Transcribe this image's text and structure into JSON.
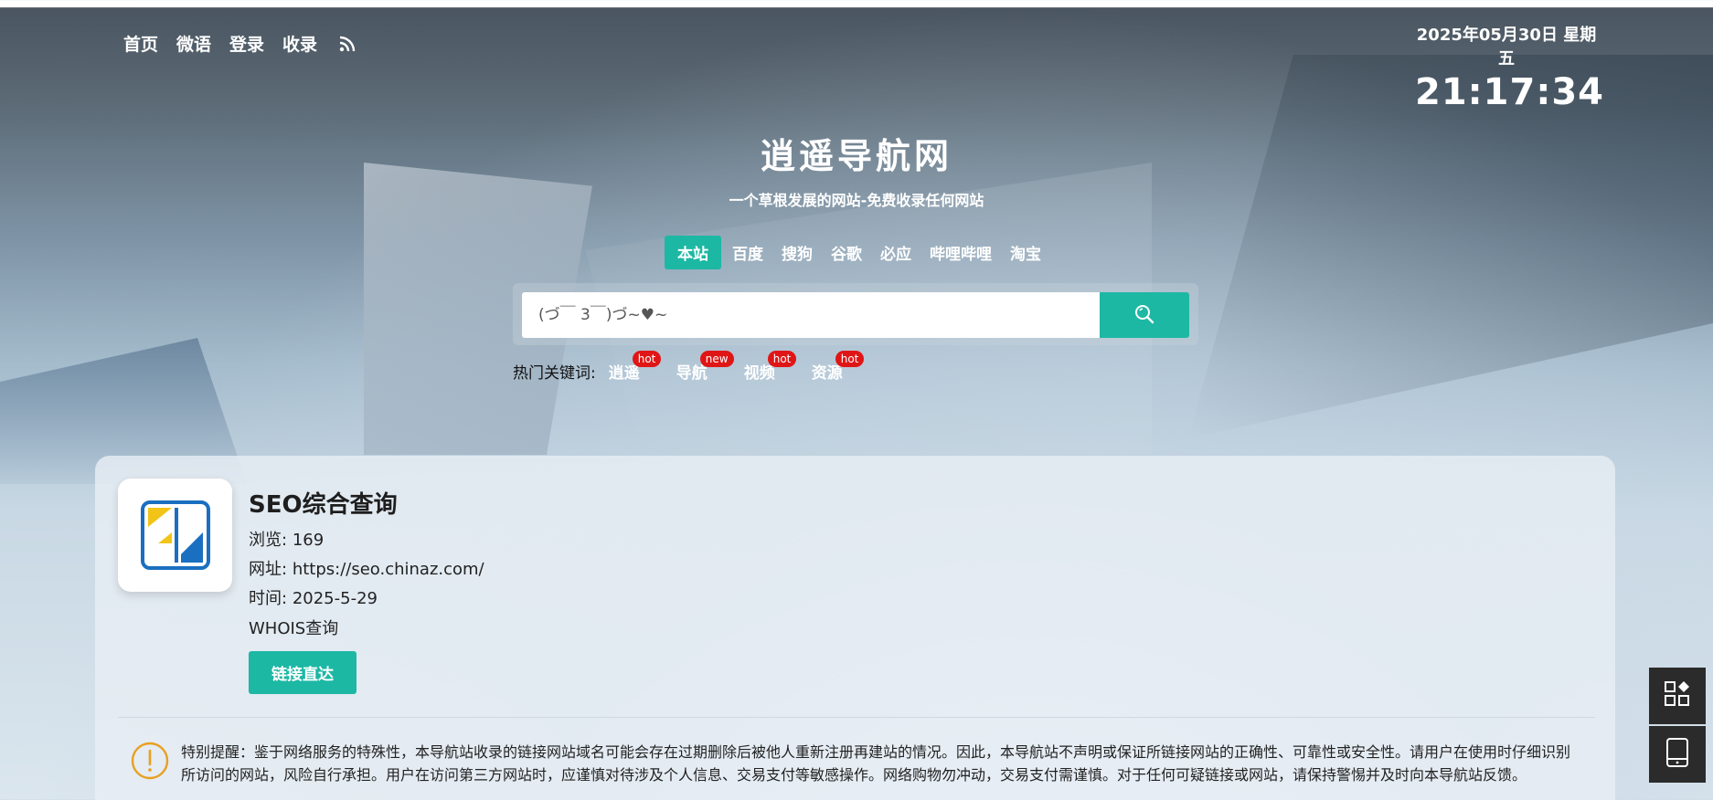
{
  "nav": {
    "items": [
      "首页",
      "微语",
      "登录",
      "收录"
    ],
    "rss_icon": "rss-icon"
  },
  "clock": {
    "date": "2025年05月30日 星期五",
    "time": "21:17:34"
  },
  "hero": {
    "title": "逍遥导航网",
    "subtitle": "一个草根发展的网站-免费收录任何网站"
  },
  "engines": {
    "tabs": [
      "本站",
      "百度",
      "搜狗",
      "谷歌",
      "必应",
      "哔哩哔哩",
      "淘宝"
    ],
    "active": "本站"
  },
  "search": {
    "placeholder": "(づ￣ 3￣)づ~♥~",
    "button_icon": "search-icon"
  },
  "hot_keywords": {
    "label": "热门关键词:",
    "items": [
      {
        "text": "逍遥",
        "badge": "hot"
      },
      {
        "text": "导航",
        "badge": "new"
      },
      {
        "text": "视频",
        "badge": "hot"
      },
      {
        "text": "资源",
        "badge": "hot"
      }
    ]
  },
  "site": {
    "name": "SEO综合查询",
    "views_label": "浏览:",
    "views": "169",
    "url_label": "网址:",
    "url": "https://seo.chinaz.com/",
    "time_label": "时间:",
    "time": "2025-5-29",
    "whois": "WHOIS查询",
    "go_button": "链接直达"
  },
  "notice": {
    "text": "特别提醒：鉴于网络服务的特殊性，本导航站收录的链接网站域名可能会存在过期删除后被他人重新注册再建站的情况。因此，本导航站不声明或保证所链接网站的正确性、可靠性或安全性。请用户在使用时仔细识别所访问的网站，风险自行承担。用户在访问第三方网站时，应谨慎对待涉及个人信息、交易支付等敏感操作。网络购物勿冲动，交易支付需谨慎。对于任何可疑链接或网站，请保持警惕并及时向本导航站反馈。"
  },
  "colors": {
    "accent": "#1cb8a4",
    "badge": "#e01616",
    "notice_icon": "#e8a020"
  },
  "floating": {
    "apps_icon": "apps-icon",
    "mobile_icon": "mobile-icon"
  }
}
